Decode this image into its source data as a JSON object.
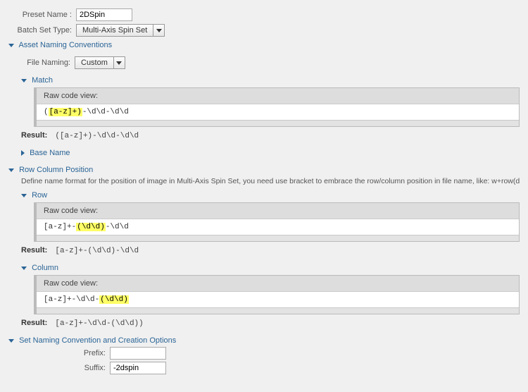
{
  "preset_name_label": "Preset Name :",
  "preset_name_value": "2DSpin",
  "batch_set_type_label": "Batch Set Type:",
  "batch_set_type_value": "Multi-Axis Spin Set",
  "asset_naming_header": "Asset Naming Conventions",
  "file_naming_label": "File Naming:",
  "file_naming_value": "Custom",
  "match": {
    "header": "Match",
    "raw_label": "Raw code view:",
    "code_pre": "(",
    "code_hl": "[a-z]+)",
    "code_post": "-\\d\\d-\\d\\d",
    "result_label": "Result:",
    "result_value": "([a-z]+)-\\d\\d-\\d\\d"
  },
  "base_name_header": "Base Name",
  "row_col_header": "Row Column Position",
  "row_col_desc": "Define name format for the position of image in Multi-Axis Spin Set, you need use bracket to embrace the row/column position in file name, like: w+row(d+)w* and w+column(d+)w*",
  "row": {
    "header": "Row",
    "raw_label": "Raw code view:",
    "code_pre": "[a-z]+-",
    "code_hl": "(\\d\\d)",
    "code_post": "-\\d\\d",
    "result_label": "Result:",
    "result_value": "[a-z]+-(\\d\\d)-\\d\\d"
  },
  "column": {
    "header": "Column",
    "raw_label": "Raw code view:",
    "code_pre": "[a-z]+-\\d\\d-",
    "code_hl": "(\\d\\d)",
    "code_post": "",
    "result_label": "Result:",
    "result_value": "[a-z]+-\\d\\d-(\\d\\d))"
  },
  "set_naming_header": "Set Naming Convention and Creation Options",
  "prefix_label": "Prefix:",
  "prefix_value": "",
  "suffix_label": "Suffix:",
  "suffix_value": "-2dspin"
}
